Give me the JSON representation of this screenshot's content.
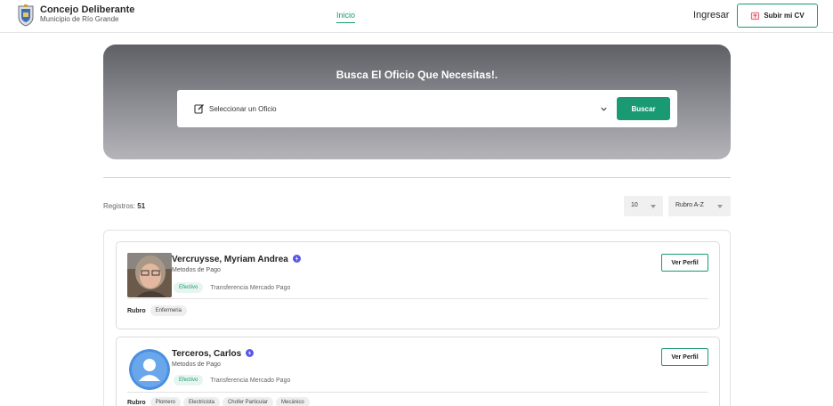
{
  "header": {
    "brand_title": "Concejo Deliberante",
    "brand_subtitle": "Municipio de Río Grande",
    "nav_inicio": "Inicio",
    "ingresar": "Ingresar",
    "subir_cv": "Subir mi CV"
  },
  "hero": {
    "title": "Busca El Oficio Que Necesitas!.",
    "select_placeholder": "Seleccionar un Oficio",
    "buscar_label": "Buscar"
  },
  "controls": {
    "registros_label": "Registros:",
    "registros_count": "51",
    "per_page": "10",
    "sort": "Rubro A-Z"
  },
  "cards": [
    {
      "name": "Vercruysse, Myriam Andrea",
      "metodos_label": "Metodos de Pago",
      "payments": [
        "Efectivo",
        "Transferencia Mercado Pago"
      ],
      "ver_perfil": "Ver Perfil",
      "rubro_label": "Rubro",
      "rubros": [
        "Enfermeria"
      ]
    },
    {
      "name": "Terceros, Carlos",
      "metodos_label": "Metodos de Pago",
      "payments": [
        "Efectivo",
        "Transferencia Mercado Pago"
      ],
      "ver_perfil": "Ver Perfil",
      "rubro_label": "Rubro",
      "rubros": [
        "Plomero",
        "Electricista",
        "Chofer Particular",
        "Mecánico"
      ]
    }
  ],
  "colors": {
    "accent": "#1a9a72",
    "verified": "#5b57e6",
    "hero_dark": "#5f5f66",
    "hero_light": "#b4b4b9"
  },
  "icons": [
    "municipal-crest-icon",
    "upload-cv-icon",
    "edit-icon",
    "chevron-down-icon",
    "verified-icon",
    "default-user-icon"
  ]
}
